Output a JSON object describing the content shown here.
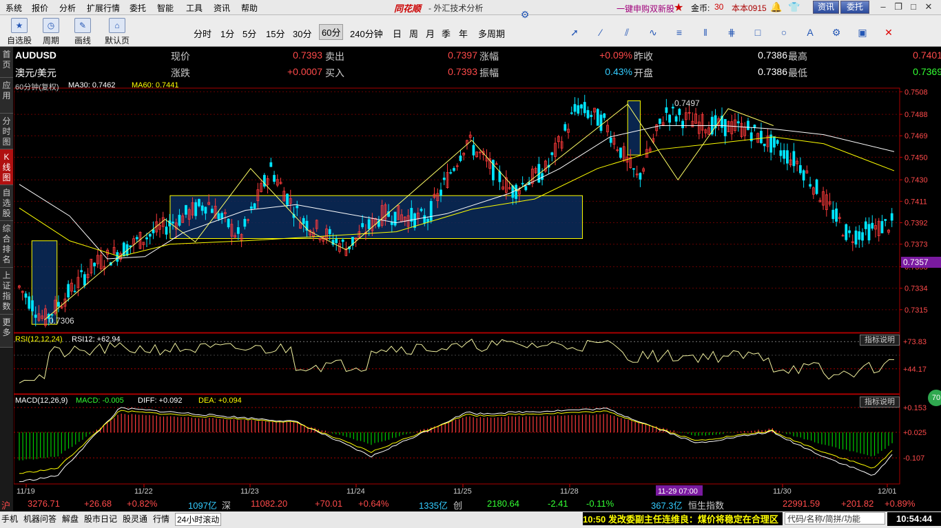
{
  "menu": {
    "items": [
      "系统",
      "报价",
      "分析",
      "扩展行情",
      "委托",
      "智能",
      "工具",
      "资讯",
      "帮助"
    ],
    "brand": "同花顺",
    "subtitle": "- 外汇技术分析",
    "ipo_link": "一键申购双新股",
    "coin_label": "金币:",
    "coin_value": "30",
    "user": "本本0915",
    "btn_news": "资讯",
    "btn_trade": "委托"
  },
  "toolbar": {
    "tools": [
      {
        "icon": "star-icon",
        "label": "自选股"
      },
      {
        "icon": "cycle-icon",
        "label": "周期"
      },
      {
        "icon": "pen-icon",
        "label": "画线"
      },
      {
        "icon": "home-icon",
        "label": "默认页"
      }
    ],
    "periods": [
      "分时",
      "1分",
      "5分",
      "15分",
      "30分",
      "60分",
      "240分钟",
      "日",
      "周",
      "月",
      "季",
      "年",
      "多周期"
    ],
    "active_period": "60分"
  },
  "left_tabs": [
    "首页",
    "应用",
    "分时图",
    "K线图",
    "自选股",
    "综合排名",
    "上证指数",
    "更多"
  ],
  "active_left_tab": "K线图",
  "quote": {
    "symbol": "AUDUSD",
    "name": "澳元/美元",
    "rows": [
      [
        {
          "l": "现价",
          "v": "0.7393"
        },
        {
          "l": "卖出",
          "v": "0.7397"
        },
        {
          "l": "涨幅",
          "v": "+0.09%"
        },
        {
          "l": "昨收",
          "v": "0.7386"
        },
        {
          "l": "最高",
          "v": "0.7401"
        }
      ],
      [
        {
          "l": "涨跌",
          "v": "+0.0007"
        },
        {
          "l": "买入",
          "v": "0.7393"
        },
        {
          "l": "振幅",
          "v": "0.43%"
        },
        {
          "l": "开盘",
          "v": "0.7386"
        },
        {
          "l": "最低",
          "v": "0.7369"
        }
      ]
    ]
  },
  "main_panel": {
    "legend_period": "60分钟(复权)",
    "ma30": "MA30: 0.7462",
    "ma60": "MA60: 0.7441",
    "high_mark": "0.7497",
    "low_mark": "0.7306",
    "current_price_tag": "0.7357"
  },
  "chart_data": [
    {
      "type": "candlestick",
      "title": "AUDUSD 60分钟",
      "y_ticks": [
        "0.7508",
        "0.7488",
        "0.7469",
        "0.7450",
        "0.7430",
        "0.7411",
        "0.7392",
        "0.7373",
        "0.7353",
        "0.7334",
        "0.7315"
      ],
      "ylim": [
        0.7296,
        0.751
      ],
      "x_ticks": [
        "11/19",
        "11/22",
        "11/23",
        "11/24",
        "11/25",
        "11/28",
        "11/30",
        "12/01"
      ],
      "crosshair_time": "11-29 07:00",
      "series": [
        {
          "name": "MA30"
        },
        {
          "name": "MA60"
        }
      ]
    },
    {
      "type": "line",
      "title": "RSI(12,12,24)",
      "label": "RSI12: +62.94",
      "y_ticks": [
        "+73.83",
        "+44.17"
      ],
      "button": "指标说明"
    },
    {
      "type": "bar",
      "title": "MACD(12,26,9)",
      "macd": "MACD: -0.005",
      "diff": "DIFF: +0.092",
      "dea": "DEA: +0.094",
      "y_ticks": [
        "+0.153",
        "+0.025",
        "-0.107"
      ],
      "button": "指标说明",
      "badge": "70"
    }
  ],
  "status_bar": [
    {
      "t": "沪",
      "c": "#ff4a4a"
    },
    {
      "t": "3276.71",
      "c": "#ff4a4a"
    },
    {
      "t": "+26.68",
      "c": "#ff4a4a"
    },
    {
      "t": "+0.82%",
      "c": "#ff4a4a"
    },
    {
      "t": "1097亿",
      "c": "#33ccff"
    },
    {
      "t": "深",
      "c": "#ccc"
    },
    {
      "t": "11082.20",
      "c": "#ff4a4a"
    },
    {
      "t": "+70.01",
      "c": "#ff4a4a"
    },
    {
      "t": "+0.64%",
      "c": "#ff4a4a"
    },
    {
      "t": "1335亿",
      "c": "#33ccff"
    },
    {
      "t": "创",
      "c": "#ccc"
    },
    {
      "t": "2180.64",
      "c": "#33ff33"
    },
    {
      "t": "-2.41",
      "c": "#33ff33"
    },
    {
      "t": "-0.11%",
      "c": "#33ff33"
    },
    {
      "t": "367.3亿",
      "c": "#33ccff"
    },
    {
      "t": "恒生指数",
      "c": "#ccc"
    },
    {
      "t": "22991.59",
      "c": "#ff4a4a"
    },
    {
      "t": "+201.82",
      "c": "#ff4a4a"
    },
    {
      "t": "+0.89%",
      "c": "#ff4a4a"
    }
  ],
  "bottom_tabs": [
    "手机",
    "机器问答",
    "解盘",
    "股市日记",
    "股灵通",
    "行情",
    "24小时滚动"
  ],
  "news_ticker": "10:50 发改委副主任连维良：煤价将稳定在合理区",
  "search_placeholder": "代码/名称/简拼/功能",
  "clock": "10:54:44",
  "colors": {
    "up": "#ff3b3b",
    "down": "#00e5ff",
    "ma30": "#ffffff",
    "ma60": "#ffff00",
    "box": "#ffff00",
    "box_fill": "#0b2b5c",
    "macd_up": "#ff3b3b",
    "macd_down": "#00cc00"
  }
}
